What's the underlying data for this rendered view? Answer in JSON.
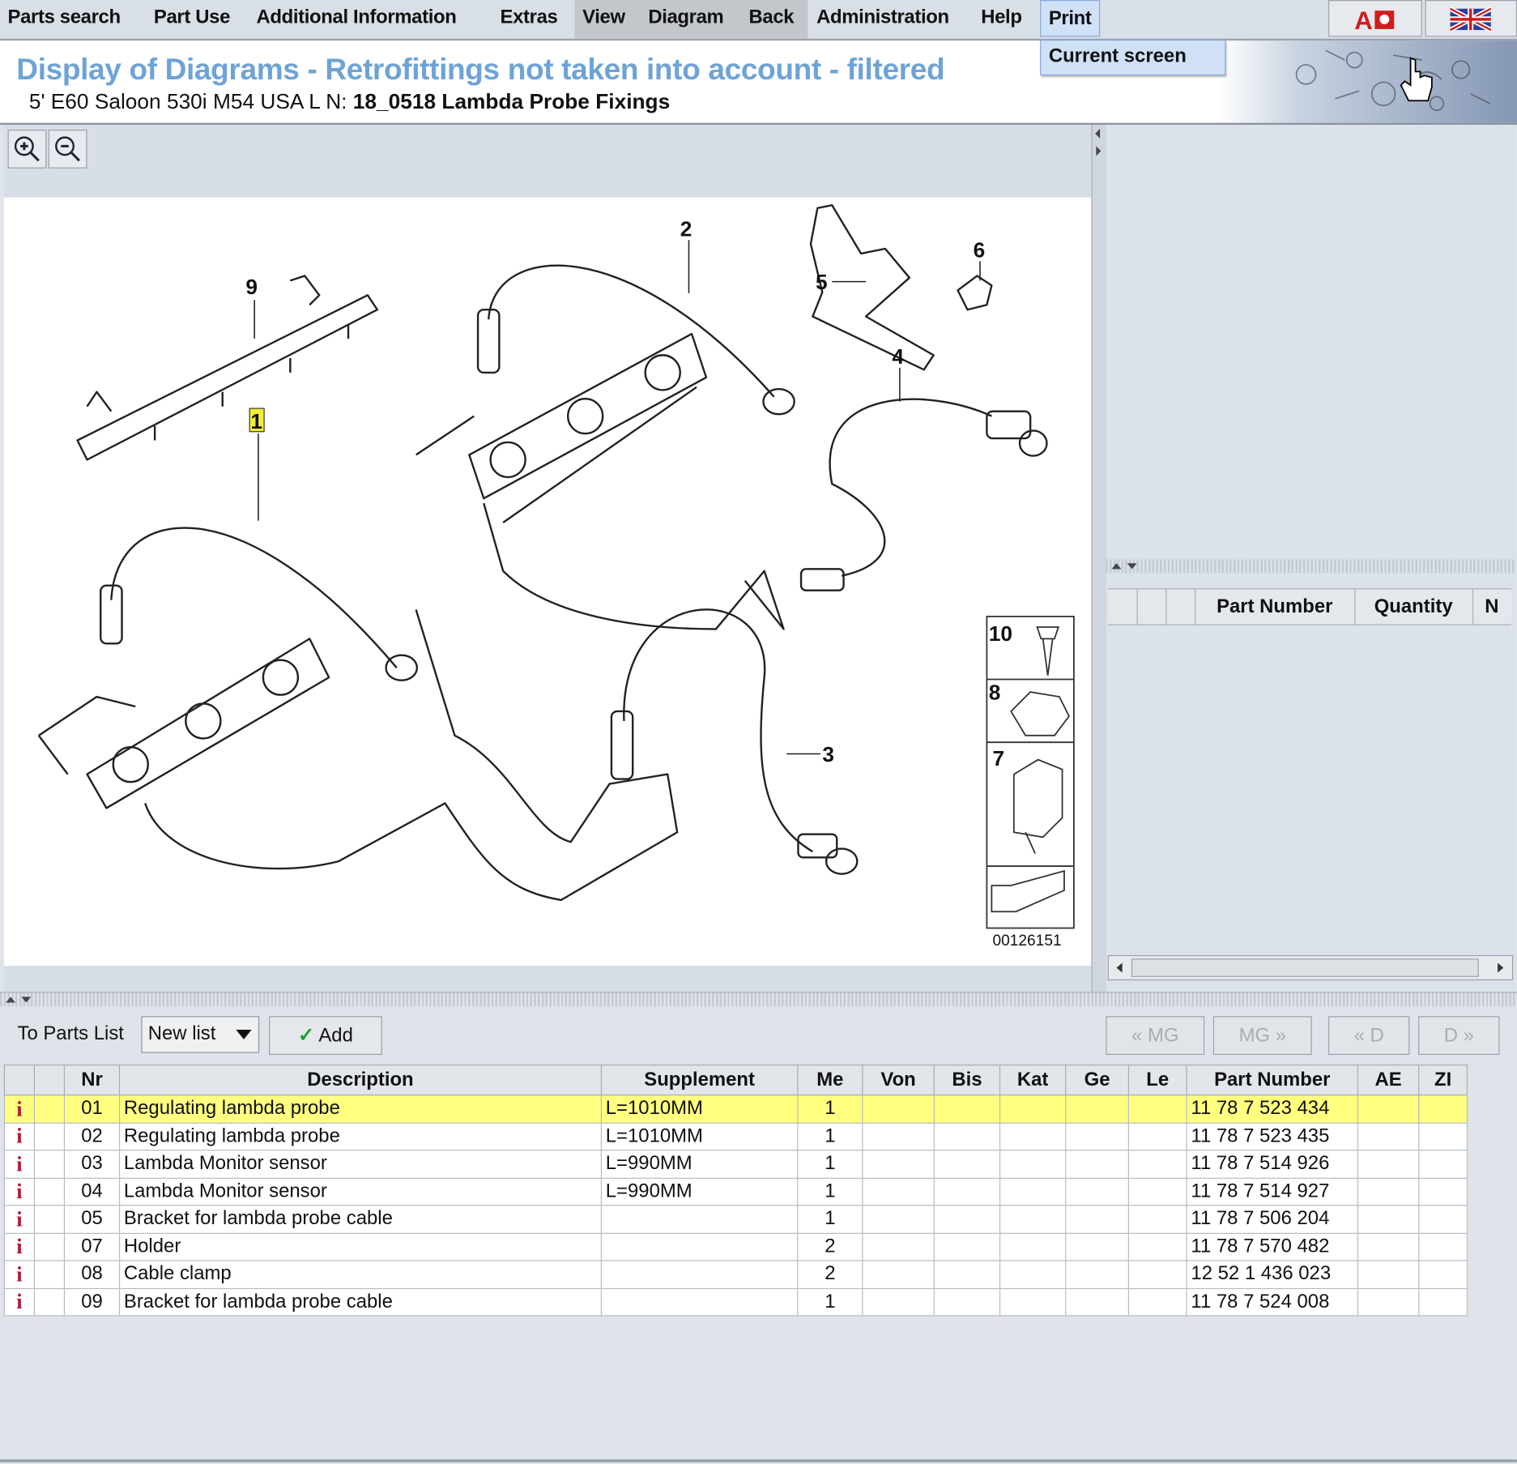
{
  "menu": {
    "items": [
      "Parts search",
      "Part Use",
      "Additional Information",
      "Extras",
      "View",
      "Diagram",
      "Back",
      "Administration",
      "Help",
      "Print"
    ],
    "print_dropdown": [
      "Current screen"
    ]
  },
  "header": {
    "title": "Display of Diagrams - Retrofittings not taken into account - filtered",
    "vehicle": "5' E60 Saloon 530i M54 USA  L N:",
    "diagram_name": "18_0518 Lambda Probe Fixings"
  },
  "diagram": {
    "callouts": [
      "1",
      "2",
      "3",
      "4",
      "5",
      "6",
      "7",
      "8",
      "9",
      "10"
    ],
    "image_number": "00126151",
    "highlighted_callout": "1"
  },
  "right_table": {
    "columns": [
      "",
      "",
      "",
      "Part Number",
      "Quantity",
      "N"
    ]
  },
  "toolbar": {
    "to_parts_list_label": "To Parts List",
    "list_select_value": "New list",
    "add_label": "Add",
    "nav_buttons": [
      "« MG",
      "MG »",
      "« D",
      "D »"
    ]
  },
  "parts_table": {
    "columns": [
      "",
      "",
      "Nr",
      "Description",
      "Supplement",
      "Me",
      "Von",
      "Bis",
      "Kat",
      "Ge",
      "Le",
      "Part Number",
      "AE",
      "ZI"
    ],
    "rows": [
      {
        "nr": "01",
        "description": "Regulating lambda probe",
        "supplement": "L=1010MM",
        "me": "1",
        "part_number": "11 78 7 523 434"
      },
      {
        "nr": "02",
        "description": "Regulating lambda probe",
        "supplement": "L=1010MM",
        "me": "1",
        "part_number": "11 78 7 523 435"
      },
      {
        "nr": "03",
        "description": "Lambda Monitor sensor",
        "supplement": "L=990MM",
        "me": "1",
        "part_number": "11 78 7 514 926"
      },
      {
        "nr": "04",
        "description": "Lambda Monitor sensor",
        "supplement": "L=990MM",
        "me": "1",
        "part_number": "11 78 7 514 927"
      },
      {
        "nr": "05",
        "description": "Bracket for lambda probe cable",
        "supplement": "",
        "me": "1",
        "part_number": "11 78 7 506 204"
      },
      {
        "nr": "07",
        "description": "Holder",
        "supplement": "",
        "me": "2",
        "part_number": "11 78 7 570 482"
      },
      {
        "nr": "08",
        "description": "Cable clamp",
        "supplement": "",
        "me": "2",
        "part_number": "12 52 1 436 023"
      },
      {
        "nr": "09",
        "description": "Bracket for lambda probe cable",
        "supplement": "",
        "me": "1",
        "part_number": "11 78 7 524 008"
      }
    ],
    "selected_row": 0,
    "info_icon": "info-icon"
  },
  "colors": {
    "title": "#6ea3d6",
    "selected_row": "#ffff80",
    "info_icon": "#b3163a",
    "menu_highlight": "#cfe0f7"
  }
}
